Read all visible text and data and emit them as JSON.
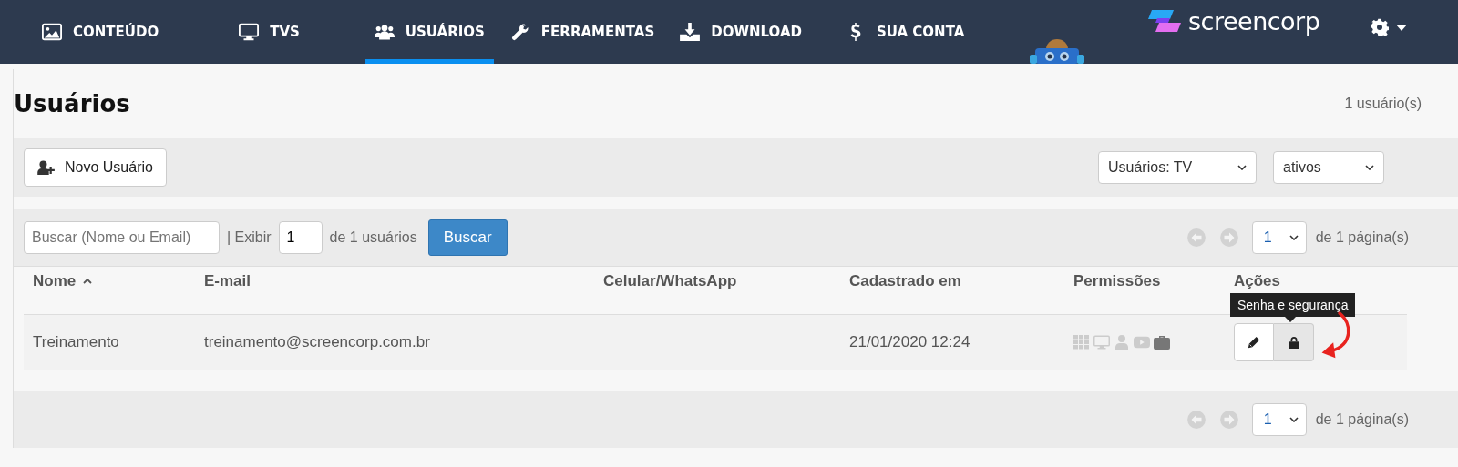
{
  "nav": {
    "items": [
      {
        "label": "CONTEÚDO",
        "kind": "image",
        "selected": false
      },
      {
        "label": "TVS",
        "kind": "monitor",
        "selected": false
      },
      {
        "label": "USUÁRIOS",
        "kind": "users",
        "selected": true
      },
      {
        "label": "FERRAMENTAS",
        "kind": "wrench",
        "selected": false
      },
      {
        "label": "DOWNLOAD",
        "kind": "download",
        "selected": false
      },
      {
        "label": "SUA CONTA",
        "kind": "dollar",
        "selected": false
      }
    ],
    "logo": "screencorp"
  },
  "header": {
    "title": "Usuários",
    "count": "1 usuário(s)"
  },
  "toolbar": {
    "new_button": "Novo Usuário",
    "filters": [
      {
        "value": "Usuários: TV"
      },
      {
        "value": "ativos"
      }
    ]
  },
  "search": {
    "placeholder": "Buscar (Nome ou Email)",
    "show_label": "| Exibir",
    "show_value": "1",
    "of_label": "de 1 usuários",
    "button": "Buscar"
  },
  "pagination_top": {
    "page": "1",
    "label": "de 1 página(s)"
  },
  "table": {
    "columns": [
      {
        "label": "Nome",
        "sorted": true
      },
      {
        "label": "E-mail",
        "sorted": false
      },
      {
        "label": "Celular/WhatsApp",
        "sorted": false
      },
      {
        "label": "Cadastrado em",
        "sorted": false
      },
      {
        "label": "Permissões",
        "sorted": false
      },
      {
        "label": "Ações",
        "sorted": false
      }
    ],
    "rows": [
      {
        "name": "Treinamento",
        "email": "treinamento@screencorp.com.br",
        "registered": "21/01/2020 12:24",
        "permissions": [
          {
            "kind": "grid",
            "on": false
          },
          {
            "kind": "monitor",
            "on": false
          },
          {
            "kind": "user",
            "on": false
          },
          {
            "kind": "video",
            "on": false
          },
          {
            "kind": "briefcase",
            "on": true
          }
        ]
      }
    ]
  },
  "tooltip": "Senha e segurança",
  "pagination_bottom": {
    "page": "1",
    "label": "de 1 página(s)"
  }
}
